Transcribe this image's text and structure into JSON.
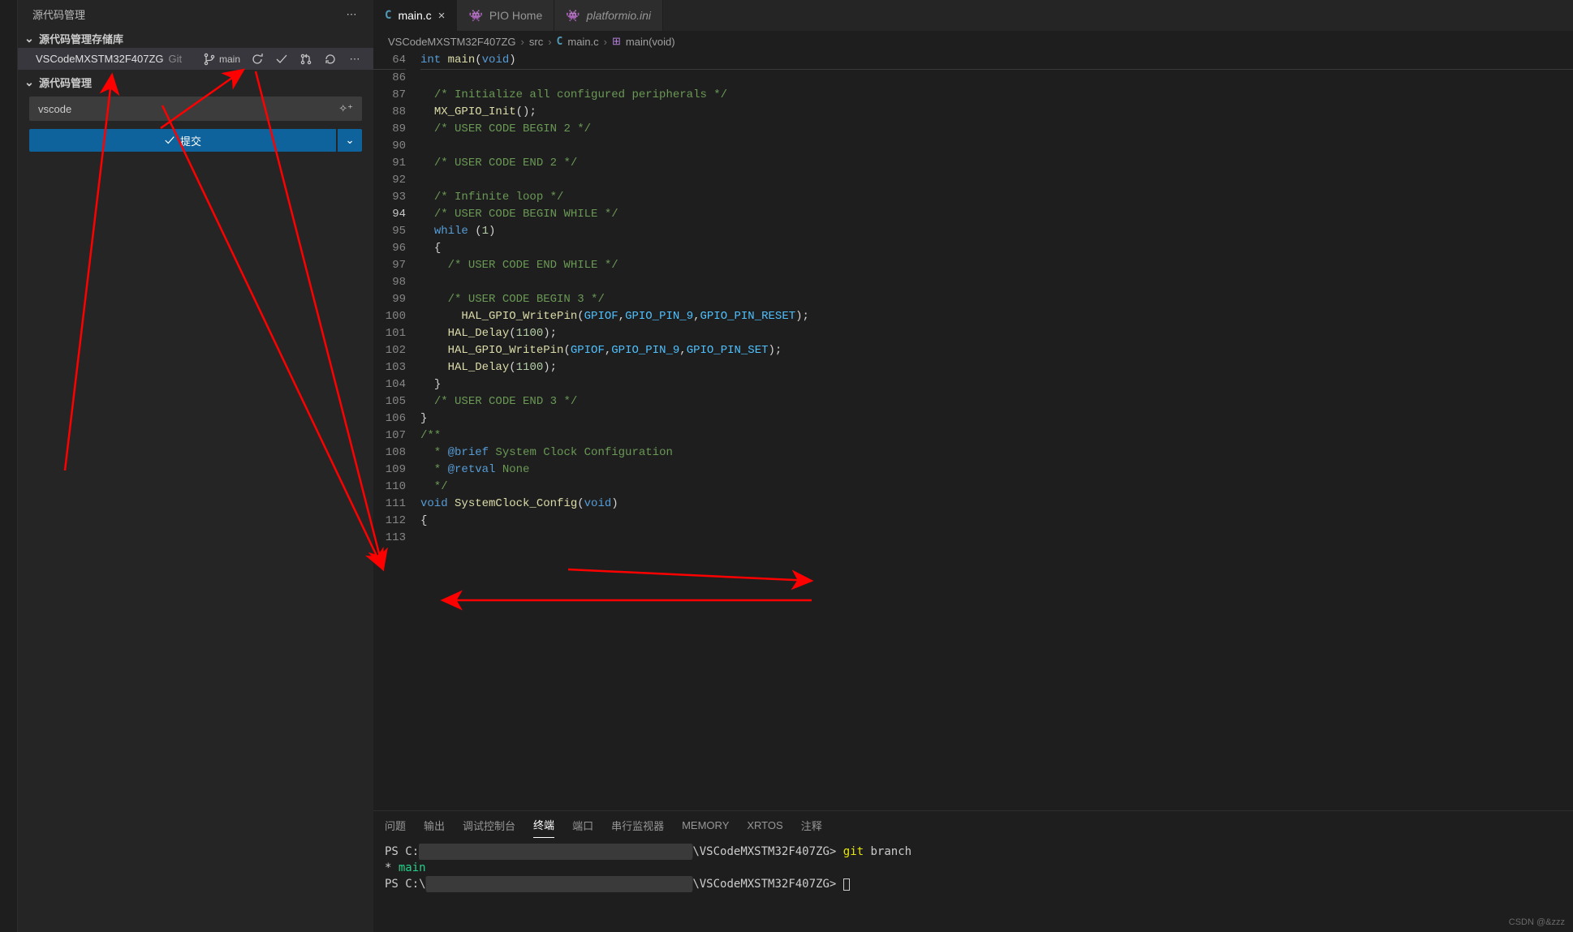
{
  "sidebar": {
    "title": "源代码管理",
    "sections": {
      "repos": "源代码管理存储库",
      "scm": "源代码管理"
    },
    "repo": {
      "name": "VSCodeMXSTM32F407ZG",
      "vcs": "Git",
      "branch": "main"
    },
    "commit_input": "vscode",
    "commit_button": "提交"
  },
  "tabs": [
    {
      "label": "main.c",
      "icon": "C",
      "active": true,
      "closable": true
    },
    {
      "label": "PIO Home",
      "icon": "pio",
      "active": false,
      "closable": false
    },
    {
      "label": "platformio.ini",
      "icon": "pio-ini",
      "active": false,
      "closable": false,
      "italic": true
    }
  ],
  "breadcrumbs": {
    "project": "VSCodeMXSTM32F407ZG",
    "folder": "src",
    "file": "main.c",
    "symbol": "main(void)"
  },
  "editor": {
    "sticky": {
      "num": "64",
      "code_html": "<span class='kw'>int</span> <span class='fn'>main</span><span class='punc'>(</span><span class='kw'>void</span><span class='punc'>)</span>"
    },
    "lines": [
      {
        "num": "86",
        "indent": 1,
        "code_html": ""
      },
      {
        "num": "87",
        "indent": 1,
        "code_html": "<span class='cmt'>/* Initialize all configured peripherals */</span>"
      },
      {
        "num": "88",
        "indent": 1,
        "code_html": "<span class='fn'>MX_GPIO_Init</span><span class='punc'>();</span>"
      },
      {
        "num": "89",
        "indent": 1,
        "code_html": "<span class='cmt'>/* USER CODE BEGIN 2 */</span>"
      },
      {
        "num": "90",
        "indent": 1,
        "code_html": ""
      },
      {
        "num": "91",
        "indent": 1,
        "code_html": "<span class='cmt'>/* USER CODE END 2 */</span>"
      },
      {
        "num": "92",
        "indent": 1,
        "code_html": ""
      },
      {
        "num": "93",
        "indent": 1,
        "code_html": "<span class='cmt'>/* Infinite loop */</span>"
      },
      {
        "num": "94",
        "indent": 1,
        "code_html": "<span class='cmt'>/* USER CODE BEGIN WHILE */</span>",
        "current": true
      },
      {
        "num": "95",
        "indent": 1,
        "code_html": "<span class='kw'>while</span> <span class='punc'>(</span><span class='num'>1</span><span class='punc'>)</span>"
      },
      {
        "num": "96",
        "indent": 1,
        "code_html": "<span class='punc'>{</span>"
      },
      {
        "num": "97",
        "indent": 2,
        "code_html": "<span class='cmt'>/* USER CODE END WHILE */</span>"
      },
      {
        "num": "98",
        "indent": 2,
        "code_html": ""
      },
      {
        "num": "99",
        "indent": 2,
        "code_html": "<span class='cmt'>/* USER CODE BEGIN 3 */</span>"
      },
      {
        "num": "100",
        "indent": 2,
        "code_html": "  <span class='fn'>HAL_GPIO_WritePin</span><span class='punc'>(</span><span class='const'>GPIOF</span><span class='punc'>,</span><span class='const'>GPIO_PIN_9</span><span class='punc'>,</span><span class='const'>GPIO_PIN_RESET</span><span class='punc'>);</span>"
      },
      {
        "num": "101",
        "indent": 2,
        "code_html": "<span class='fn'>HAL_Delay</span><span class='punc'>(</span><span class='num'>1100</span><span class='punc'>);</span>"
      },
      {
        "num": "102",
        "indent": 2,
        "code_html": "<span class='fn'>HAL_GPIO_WritePin</span><span class='punc'>(</span><span class='const'>GPIOF</span><span class='punc'>,</span><span class='const'>GPIO_PIN_9</span><span class='punc'>,</span><span class='const'>GPIO_PIN_SET</span><span class='punc'>);</span>"
      },
      {
        "num": "103",
        "indent": 2,
        "code_html": "<span class='fn'>HAL_Delay</span><span class='punc'>(</span><span class='num'>1100</span><span class='punc'>);</span>"
      },
      {
        "num": "104",
        "indent": 1,
        "code_html": "<span class='punc'>}</span>"
      },
      {
        "num": "105",
        "indent": 1,
        "code_html": "<span class='cmt'>/* USER CODE END 3 */</span>"
      },
      {
        "num": "106",
        "indent": 0,
        "code_html": "<span class='punc'>}</span>"
      },
      {
        "num": "107",
        "indent": 0,
        "code_html": ""
      },
      {
        "num": "108",
        "indent": 0,
        "code_html": "<span class='cmt-doc'>/**</span>"
      },
      {
        "num": "109",
        "indent": 0,
        "code_html": "<span class='cmt-doc'>  * <span class='tag'>@brief</span> System Clock Configuration</span>"
      },
      {
        "num": "110",
        "indent": 0,
        "code_html": "<span class='cmt-doc'>  * <span class='tag'>@retval</span> None</span>"
      },
      {
        "num": "111",
        "indent": 0,
        "code_html": "<span class='cmt-doc'>  */</span>"
      },
      {
        "num": "112",
        "indent": 0,
        "code_html": "<span class='kw'>void</span> <span class='fn'>SystemClock_Config</span><span class='punc'>(</span><span class='kw'>void</span><span class='punc'>)</span>"
      },
      {
        "num": "113",
        "indent": 0,
        "code_html": "<span class='punc'>{</span>"
      }
    ]
  },
  "panel": {
    "tabs": [
      "问题",
      "输出",
      "调试控制台",
      "终端",
      "端口",
      "串行监视器",
      "MEMORY",
      "XRTOS",
      "注释"
    ],
    "active": "终端"
  },
  "terminal": {
    "prompt_prefix": "PS C:",
    "path_suffix": "\\VSCodeMXSTM32F407ZG>",
    "cmd": "git",
    "cmd_arg": "branch",
    "result_marker": "*",
    "result_branch": "main",
    "prompt2_prefix": "PS C:\\",
    "path2_suffix": "\\VSCodeMXSTM32F407ZG>"
  },
  "watermark": "CSDN @&zzz"
}
